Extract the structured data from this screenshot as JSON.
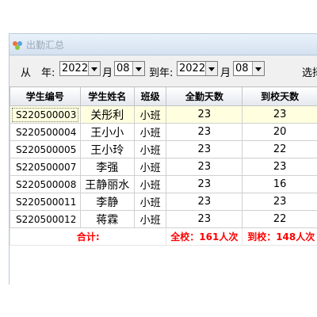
{
  "window": {
    "title": "出勤汇总"
  },
  "filter": {
    "from_label": "从",
    "year_label": "年:",
    "from_year": "2022",
    "month_label": "月",
    "from_month": "08",
    "to_year_label": "到年:",
    "to_year": "2022",
    "to_month_label": "月",
    "to_month": "08",
    "select_label": "选择"
  },
  "table": {
    "headers": [
      "学生编号",
      "学生姓名",
      "班级",
      "全勤天数",
      "到校天数"
    ],
    "rows": [
      {
        "id": "S220500003",
        "name": "关彤利",
        "class": "小班",
        "full": "23",
        "present": "23"
      },
      {
        "id": "S220500004",
        "name": "王小小",
        "class": "小班",
        "full": "23",
        "present": "20"
      },
      {
        "id": "S220500005",
        "name": "王小玲",
        "class": "小班",
        "full": "23",
        "present": "22"
      },
      {
        "id": "S220500007",
        "name": "李强",
        "class": "小班",
        "full": "23",
        "present": "23"
      },
      {
        "id": "S220500008",
        "name": "王静丽水",
        "class": "小班",
        "full": "23",
        "present": "16"
      },
      {
        "id": "S220500011",
        "name": "李静",
        "class": "小班",
        "full": "23",
        "present": "23"
      },
      {
        "id": "S220500012",
        "name": "蒋霖",
        "class": "小班",
        "full": "23",
        "present": "22"
      }
    ],
    "summary": {
      "label": "合计:",
      "full_total": "全校：161人次",
      "present_total": "到校：148人次"
    }
  },
  "colors": {
    "summary_text": "#ff0000",
    "selected_row": "#ffffe0",
    "title_text": "#9aa9b8"
  },
  "icons": {
    "app": "app-logo-icon",
    "dropdown": "chevron-down-icon"
  }
}
